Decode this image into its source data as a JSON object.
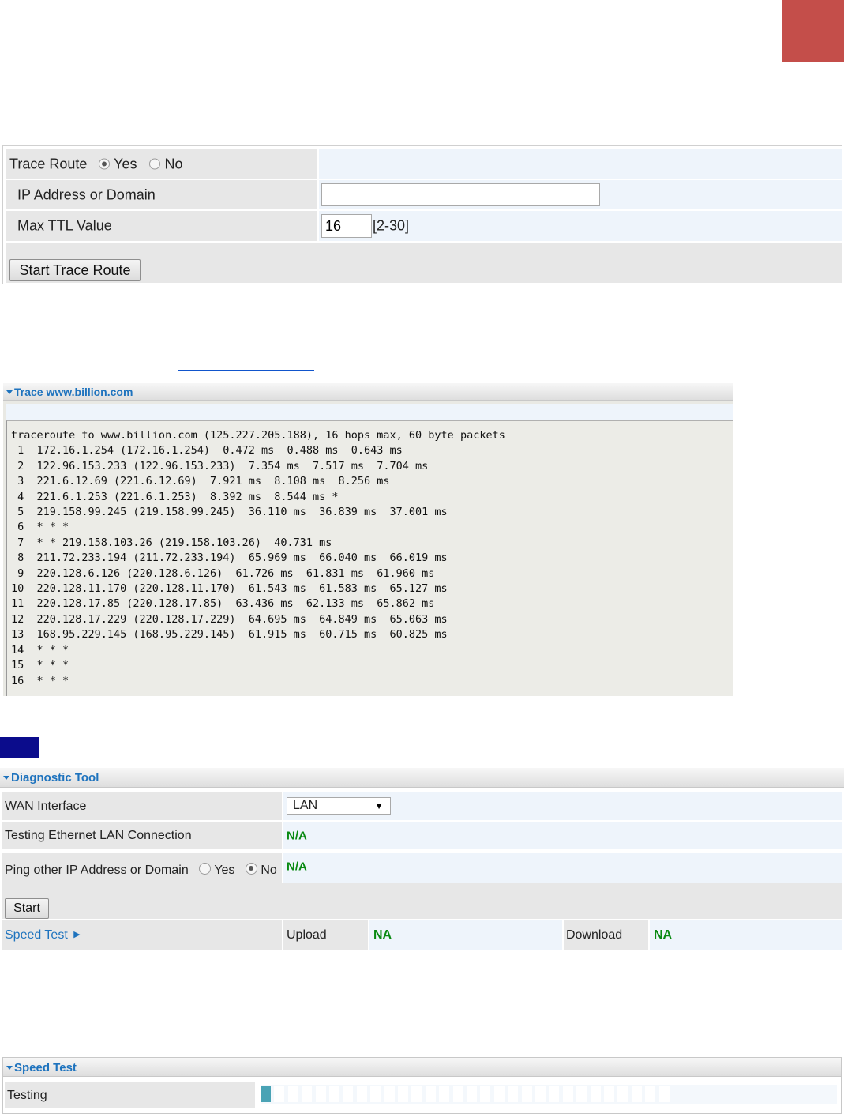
{
  "colors": {
    "red_tab": "#c44e4a",
    "navy_marker": "#0b0c8c",
    "link_blue": "#1e73be",
    "status_green": "#0a8a12",
    "progress_fill": "#4aa3b5"
  },
  "trace_form": {
    "trace_route_label": "Trace Route",
    "yes_label": "Yes",
    "no_label": "No",
    "trace_route_selected": "Yes",
    "ip_label": "IP Address or Domain",
    "ip_value": "",
    "ttl_label": "Max TTL Value",
    "ttl_value": "16",
    "ttl_range": "[2-30]",
    "start_button": "Start Trace Route"
  },
  "trace_panel": {
    "title": "Trace www.billion.com",
    "lines": [
      "traceroute to www.billion.com (125.227.205.188), 16 hops max, 60 byte packets",
      " 1  172.16.1.254 (172.16.1.254)  0.472 ms  0.488 ms  0.643 ms",
      " 2  122.96.153.233 (122.96.153.233)  7.354 ms  7.517 ms  7.704 ms",
      " 3  221.6.12.69 (221.6.12.69)  7.921 ms  8.108 ms  8.256 ms",
      " 4  221.6.1.253 (221.6.1.253)  8.392 ms  8.544 ms *",
      " 5  219.158.99.245 (219.158.99.245)  36.110 ms  36.839 ms  37.001 ms",
      " 6  * * *",
      " 7  * * 219.158.103.26 (219.158.103.26)  40.731 ms",
      " 8  211.72.233.194 (211.72.233.194)  65.969 ms  66.040 ms  66.019 ms",
      " 9  220.128.6.126 (220.128.6.126)  61.726 ms  61.831 ms  61.960 ms",
      "10  220.128.11.170 (220.128.11.170)  61.543 ms  61.583 ms  65.127 ms",
      "11  220.128.17.85 (220.128.17.85)  63.436 ms  62.133 ms  65.862 ms",
      "12  220.128.17.229 (220.128.17.229)  64.695 ms  64.849 ms  65.063 ms",
      "13  168.95.229.145 (168.95.229.145)  61.915 ms  60.715 ms  60.825 ms",
      "14  * * *",
      "15  * * *",
      "16  * * *"
    ]
  },
  "diagnostic_tool": {
    "title": "Diagnostic Tool",
    "wan_label": "WAN Interface",
    "wan_selected": "LAN",
    "lan_test_label": "Testing Ethernet LAN Connection",
    "lan_test_value": "N/A",
    "ping_label": "Ping other IP Address or Domain",
    "yes_label": "Yes",
    "no_label": "No",
    "ping_selected": "No",
    "ping_value": "N/A",
    "start_button": "Start",
    "speed_test_link": "Speed Test",
    "upload_label": "Upload",
    "upload_value": "NA",
    "download_label": "Download",
    "download_value": "NA"
  },
  "speed_test": {
    "title": "Speed Test",
    "testing_label": "Testing",
    "segments_total": 30,
    "segments_filled": 1
  }
}
